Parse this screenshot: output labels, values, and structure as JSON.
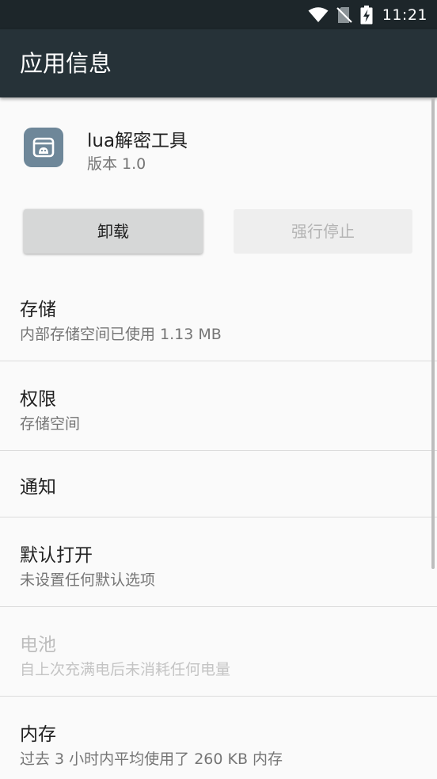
{
  "status_bar": {
    "time": "11:21",
    "icons": [
      "wifi-icon",
      "no-sim-icon",
      "battery-charging-icon"
    ]
  },
  "toolbar": {
    "title": "应用信息"
  },
  "app": {
    "name": "lua解密工具",
    "version": "版本 1.0",
    "icon": "app-icon"
  },
  "buttons": {
    "uninstall": "卸载",
    "force_stop": "强行停止"
  },
  "items": [
    {
      "title": "存储",
      "summary": "内部存储空间已使用 1.13 MB"
    },
    {
      "title": "权限",
      "summary": "存储空间"
    },
    {
      "title": "通知",
      "summary": ""
    },
    {
      "title": "默认打开",
      "summary": "未设置任何默认选项"
    },
    {
      "title": "电池",
      "summary": "自上次充满电后未消耗任何电量",
      "disabled": true
    },
    {
      "title": "内存",
      "summary": "过去 3 小时内平均使用了 260 KB 内存"
    }
  ],
  "colors": {
    "status_bar": "#1d262a",
    "toolbar": "#263238",
    "background": "#fafafa",
    "app_icon": "#6e8799"
  }
}
